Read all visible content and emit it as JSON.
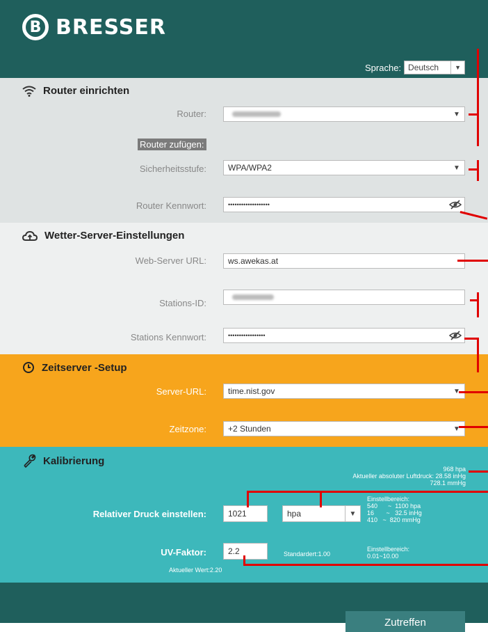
{
  "brand": "BRESSER",
  "brand_letter": "B",
  "language": {
    "label": "Sprache:",
    "value": "Deutsch"
  },
  "router": {
    "title": "Router einrichten",
    "router_label": "Router:",
    "add_label": "Router zufügen:",
    "security_label": "Sicherheitsstufe:",
    "security_value": "WPA/WPA2",
    "password_label": "Router Kennwort:",
    "password_value": "•••••••••••••••••••"
  },
  "wetter": {
    "title": "Wetter-Server-Einstellungen",
    "url_label": "Web-Server URL:",
    "url_value": "ws.awekas.at",
    "id_label": "Stations-ID:",
    "pw_label": "Stations Kennwort:",
    "pw_value": "•••••••••••••••••"
  },
  "zeit": {
    "title": "Zeitserver -Setup",
    "url_label": "Server-URL:",
    "url_value": "time.nist.gov",
    "tz_label": "Zeitzone:",
    "tz_value": "+2 Stunden"
  },
  "kalib": {
    "title": "Kalibrierung",
    "abs_line1": "968 hpa",
    "abs_line2": "Aktueller absoluter Luftdruck: 28.58 inHg",
    "abs_line3": "728.1 mmHg",
    "rel_label": "Relativer Druck einstellen:",
    "rel_value": "1021",
    "unit_value": "hpa",
    "range_title": "Einstellbereich:",
    "range_1": "540      ~  1100 hpa",
    "range_2": "16       ~   32.5 inHg",
    "range_3": "410   ~  820 mmHg",
    "uv_label": "UV-Faktor:",
    "uv_value": "2.2",
    "uv_default": "Standardert:1.00",
    "uv_range_title": "Einstellbereich:",
    "uv_range": "0.01~10.00",
    "uv_current": "Aktueller Wert:2.20"
  },
  "submit_label": "Zutreffen",
  "colors": {
    "header": "#1f5f5c",
    "zeit": "#f7a51c",
    "kalib": "#3db8bb",
    "annotation": "#e00000"
  }
}
